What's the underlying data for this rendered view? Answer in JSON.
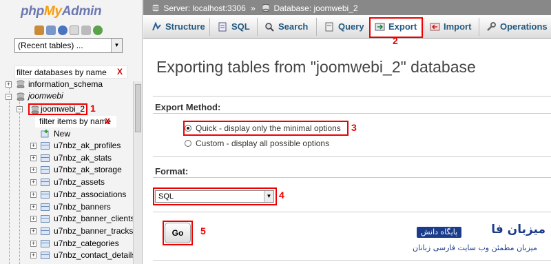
{
  "logo": {
    "php": "php",
    "my": "My",
    "admin": "Admin"
  },
  "nav": {
    "recent_tables": "(Recent tables) ...",
    "filter_databases": "filter databases by name",
    "filter_clear": "X",
    "databases": [
      {
        "name": "information_schema"
      },
      {
        "name": "joomwebi"
      }
    ],
    "selected_db": "joomwebi_2",
    "filter_items": "filter items by name",
    "new_label": "New",
    "tables": [
      "u7nbz_ak_profiles",
      "u7nbz_ak_stats",
      "u7nbz_ak_storage",
      "u7nbz_assets",
      "u7nbz_associations",
      "u7nbz_banners",
      "u7nbz_banner_clients",
      "u7nbz_banner_tracks",
      "u7nbz_categories",
      "u7nbz_contact_details"
    ]
  },
  "breadcrumb": {
    "server": "Server: localhost:3306",
    "separator": "»",
    "database": "Database: joomwebi_2"
  },
  "tabs": {
    "structure": "Structure",
    "sql": "SQL",
    "search": "Search",
    "query": "Query",
    "export": "Export",
    "import": "Import",
    "operations": "Operations"
  },
  "main": {
    "title": "Exporting tables from \"joomwebi_2\" database",
    "export_method_label": "Export Method:",
    "method_quick": "Quick - display only the minimal options",
    "method_custom": "Custom - display all possible options",
    "format_label": "Format:",
    "format_value": "SQL",
    "go_label": "Go"
  },
  "annotations": {
    "n1": "1",
    "n2": "2",
    "n3": "3",
    "n4": "4",
    "n5": "5"
  },
  "watermark": {
    "title": "میزبان فا",
    "badge": "پایگاه دانش",
    "subtitle": "میزبان مطمئن وب سایت فارسی زبانان"
  },
  "colors": {
    "annotation_red": "#e00000",
    "tab_text": "#235a81",
    "breadcrumb_bg": "#888888"
  }
}
